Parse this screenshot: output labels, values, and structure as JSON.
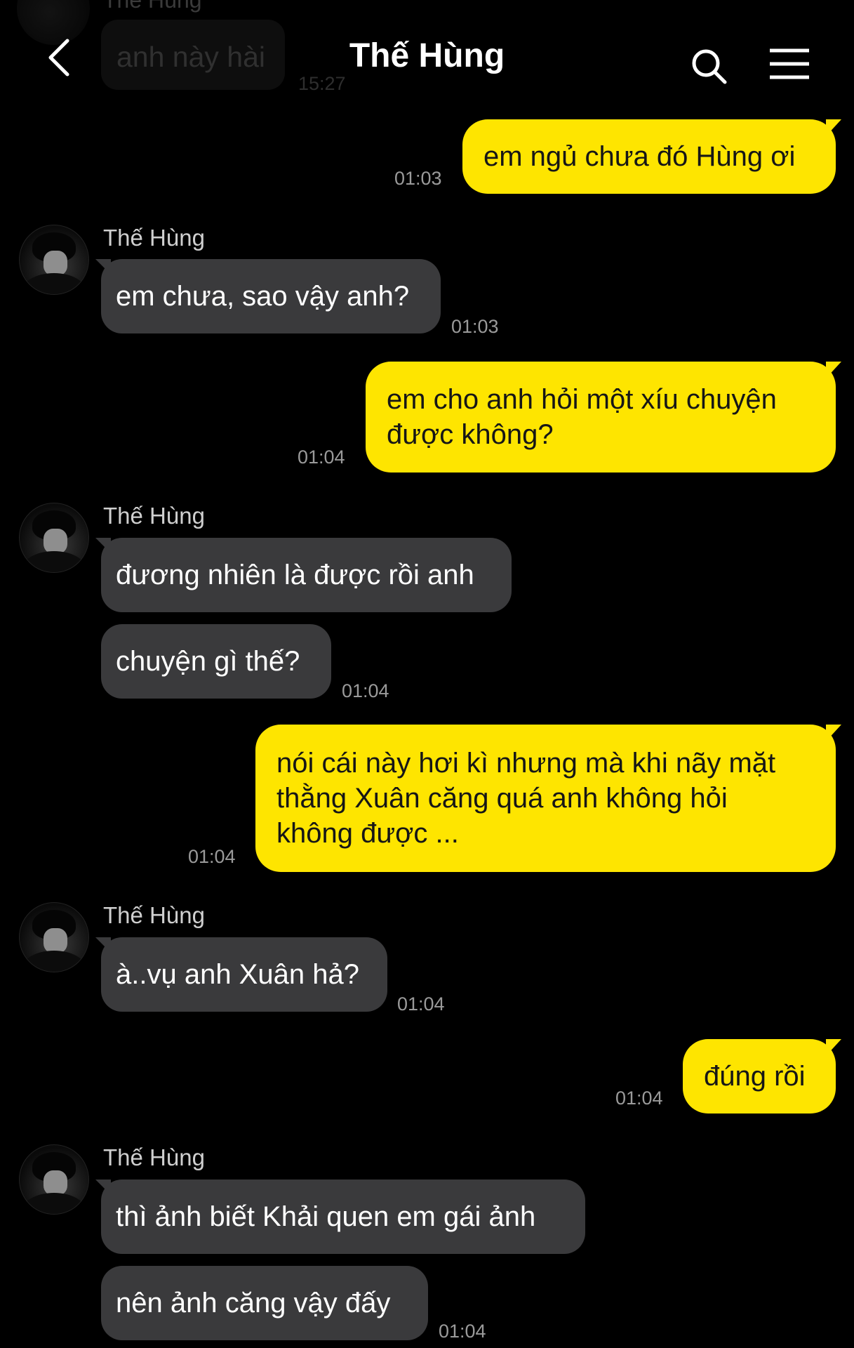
{
  "header": {
    "title": "Thế Hùng"
  },
  "previous_message": {
    "sender": "Thế Hùng",
    "text": "anh này hài",
    "time": "15:27"
  },
  "messages": [
    {
      "side": "out",
      "text": "em ngủ chưa đó Hùng ơi",
      "time": "01:03"
    },
    {
      "side": "in",
      "sender": "Thế Hùng",
      "text": "em chưa, sao vậy anh?",
      "time": "01:03"
    },
    {
      "side": "out",
      "lines": [
        "em cho anh hỏi một xíu chuyện",
        "được không?"
      ],
      "time": "01:04"
    },
    {
      "side": "in",
      "sender": "Thế Hùng",
      "text": "đương nhiên là được rồi anh"
    },
    {
      "side": "in",
      "text": "chuyện gì thế?",
      "time": "01:04"
    },
    {
      "side": "out",
      "lines": [
        "nói cái này hơi kì nhưng mà khi nãy mặt",
        "thằng Xuân căng quá anh không hỏi",
        "không được ..."
      ],
      "time": "01:04"
    },
    {
      "side": "in",
      "sender": "Thế Hùng",
      "text": "à..vụ anh Xuân hả?",
      "time": "01:04"
    },
    {
      "side": "out",
      "text": "đúng rồi",
      "time": "01:04"
    },
    {
      "side": "in",
      "sender": "Thế Hùng",
      "text": "thì ảnh biết Khải quen em gái ảnh"
    },
    {
      "side": "in",
      "text": "nên ảnh căng vậy đấy",
      "time": "01:04"
    }
  ],
  "colors": {
    "background": "#000000",
    "outgoing_bubble": "#fee500",
    "incoming_bubble": "#3a3a3c",
    "timestamp": "#9a9a9a"
  },
  "icons": [
    "back-arrow-icon",
    "search-icon",
    "menu-icon"
  ]
}
